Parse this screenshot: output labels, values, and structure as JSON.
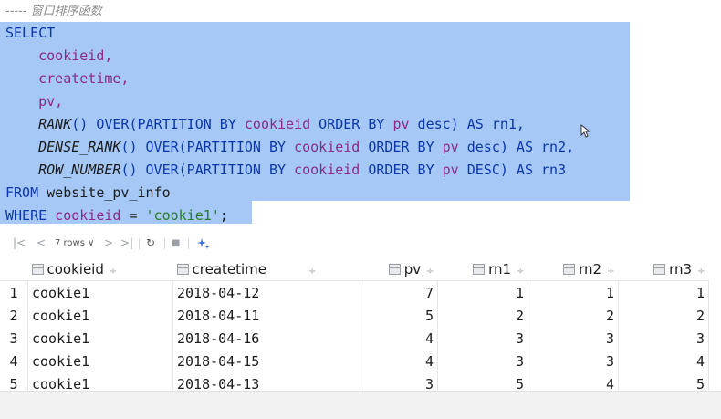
{
  "editor": {
    "comment": "----- 窗口排序函数",
    "lines": [
      {
        "kw": "SELECT"
      },
      {
        "id": "cookieid,"
      },
      {
        "id": "createtime,"
      },
      {
        "id": "pv,"
      },
      {
        "fn": "RANK",
        "rest1": "() OVER(PARTITION BY ",
        "col1": "cookieid",
        "rest2": " ORDER BY ",
        "col2": "pv",
        "rest3": " desc) AS rn1,"
      },
      {
        "fn": "DENSE_RANK",
        "rest1": "() OVER(PARTITION BY ",
        "col1": "cookieid",
        "rest2": " ORDER BY ",
        "col2": "pv",
        "rest3": " desc) AS rn2,"
      },
      {
        "fn": "ROW_NUMBER",
        "rest1": "() OVER(PARTITION BY ",
        "col1": "cookieid",
        "rest2": " ORDER BY ",
        "col2": "pv",
        "rest3": " DESC) AS rn3"
      },
      {
        "kw": "FROM",
        "rest": " website_pv_info"
      },
      {
        "kw": "WHERE",
        "col": " cookieid",
        "op": " = ",
        "str": "'cookie1'",
        "end": ";"
      }
    ]
  },
  "results": {
    "toolbar": {
      "first_page": "|<",
      "prev_page": "<",
      "rows_label": "7 rows ∨",
      "next_page": ">",
      "last_page": ">|",
      "refresh": "↻",
      "stop": "■",
      "pin": "⁺"
    },
    "columns": [
      "cookieid",
      "createtime",
      "pv",
      "rn1",
      "rn2",
      "rn3"
    ],
    "rows": [
      [
        "1",
        "cookie1",
        "2018-04-12",
        "7",
        "1",
        "1",
        "1"
      ],
      [
        "2",
        "cookie1",
        "2018-04-11",
        "5",
        "2",
        "2",
        "2"
      ],
      [
        "3",
        "cookie1",
        "2018-04-16",
        "4",
        "3",
        "3",
        "3"
      ],
      [
        "4",
        "cookie1",
        "2018-04-15",
        "4",
        "3",
        "3",
        "4"
      ],
      [
        "5",
        "cookie1",
        "2018-04-13",
        "3",
        "5",
        "4",
        "5"
      ]
    ]
  }
}
